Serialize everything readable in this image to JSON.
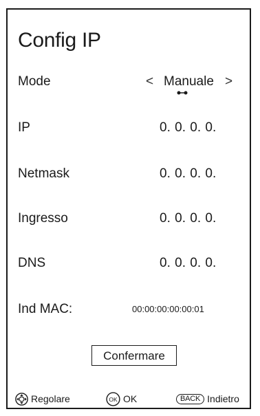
{
  "title": "Config IP",
  "mode": {
    "label": "Mode",
    "value": "Manuale",
    "arrow_left": "<",
    "arrow_right": ">"
  },
  "fields": {
    "ip": {
      "label": "IP",
      "value": "0. 0. 0. 0."
    },
    "netmask": {
      "label": "Netmask",
      "value": "0. 0. 0. 0."
    },
    "gateway": {
      "label": "Ingresso",
      "value": "0. 0. 0. 0."
    },
    "dns": {
      "label": "DNS",
      "value": "0. 0. 0. 0."
    },
    "mac": {
      "label": "Ind MAC:",
      "value": "00:00:00:00:00:01"
    }
  },
  "confirm_label": "Confermare",
  "footer": {
    "adjust": {
      "icon": "dpad-icon",
      "label": "Regolare"
    },
    "ok": {
      "icon": "ok-button-icon",
      "badge": "OK",
      "label": "OK"
    },
    "back": {
      "icon": "back-button-icon",
      "badge": "BACK",
      "label": "Indietro"
    }
  }
}
